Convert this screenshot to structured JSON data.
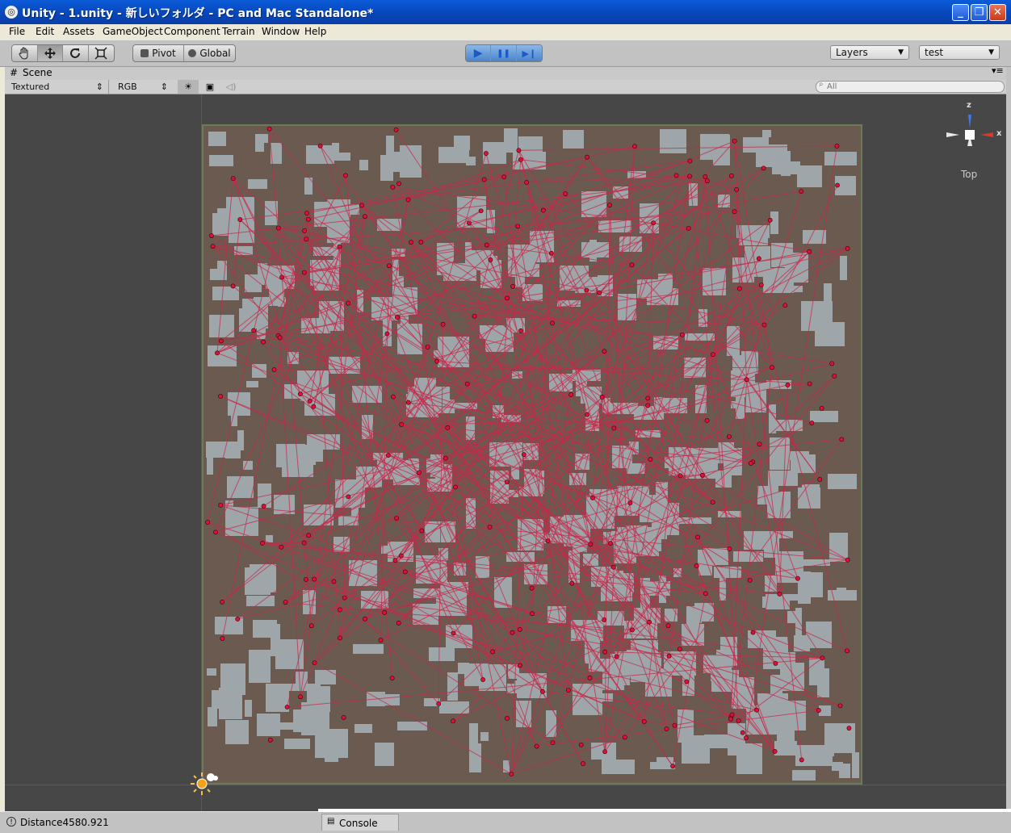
{
  "window": {
    "title": "Unity - 1.unity - 新しいフォルダ - PC and Mac Standalone*",
    "buttons": {
      "minimize": "_",
      "restore": "❐",
      "close": "✕"
    }
  },
  "menu": [
    "File",
    "Edit",
    "Assets",
    "GameObject",
    "Component",
    "Terrain",
    "Window",
    "Help"
  ],
  "toolbar": {
    "tools": [
      "hand-icon",
      "move-icon",
      "rotate-icon",
      "scale-icon"
    ],
    "pivot_label": "Pivot",
    "global_label": "Global",
    "play": {
      "play": "▶",
      "pause": "❚❚",
      "step": "▶❙"
    },
    "layers_label": "Layers",
    "layout_label": "test"
  },
  "scene_tab": {
    "label": "Scene"
  },
  "scene_bar": {
    "draw_mode": "Textured",
    "render_mode": "RGB",
    "search_placeholder": "All"
  },
  "gizmo": {
    "y_label": "z",
    "x_label": "x",
    "view_label": "Top"
  },
  "status": {
    "message": "Distance4580.921",
    "console_tab": "Console"
  },
  "colors": {
    "ground": "#6b5a50",
    "building": "#9ea6aa",
    "path": "#c42a4a",
    "node": "#e0103a",
    "viewport_bg": "#474747"
  }
}
